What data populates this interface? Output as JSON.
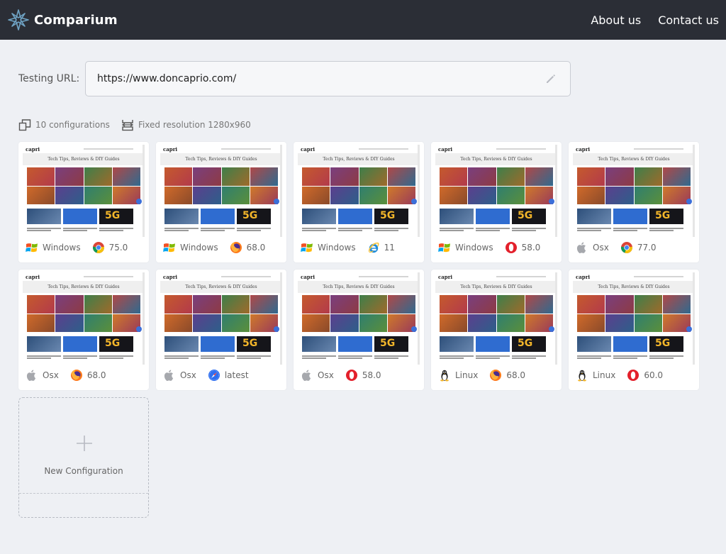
{
  "header": {
    "brand": "Comparium",
    "nav": [
      {
        "label": "About us"
      },
      {
        "label": "Contact us"
      }
    ]
  },
  "testing_url": {
    "label": "Testing URL:",
    "value": "https://www.doncaprio.com/"
  },
  "info": {
    "configurations": "10 configurations",
    "resolution": "Fixed resolution 1280x960"
  },
  "screenshot_preview": {
    "site_logo": "capri",
    "banner": "Tech Tips, Reviews & DIY Guides"
  },
  "configs": [
    {
      "os": "Windows",
      "os_icon": "windows-icon",
      "browser_icon": "chrome-icon",
      "version": "75.0"
    },
    {
      "os": "Windows",
      "os_icon": "windows-icon",
      "browser_icon": "firefox-icon",
      "version": "68.0"
    },
    {
      "os": "Windows",
      "os_icon": "windows-icon",
      "browser_icon": "ie-icon",
      "version": "11"
    },
    {
      "os": "Windows",
      "os_icon": "windows-icon",
      "browser_icon": "opera-icon",
      "version": "58.0"
    },
    {
      "os": "Osx",
      "os_icon": "apple-icon",
      "browser_icon": "chrome-icon",
      "version": "77.0"
    },
    {
      "os": "Osx",
      "os_icon": "apple-icon",
      "browser_icon": "firefox-icon",
      "version": "68.0"
    },
    {
      "os": "Osx",
      "os_icon": "apple-icon",
      "browser_icon": "safari-icon",
      "version": "latest"
    },
    {
      "os": "Osx",
      "os_icon": "apple-icon",
      "browser_icon": "opera-icon",
      "version": "58.0"
    },
    {
      "os": "Linux",
      "os_icon": "linux-icon",
      "browser_icon": "firefox-icon",
      "version": "68.0"
    },
    {
      "os": "Linux",
      "os_icon": "linux-icon",
      "browser_icon": "opera-icon",
      "version": "60.0"
    }
  ],
  "new_config": {
    "label": "New Configuration"
  },
  "colors": {
    "header_bg": "#2b2e36",
    "page_bg": "#eef0f4",
    "chrome_red": "#db4437",
    "chrome_yellow": "#f4c20d",
    "chrome_green": "#0f9d58",
    "chrome_blue": "#4285f4",
    "firefox_orange": "#ff7b1a",
    "opera_red": "#e3202b",
    "ie_blue": "#1f8cdb"
  }
}
